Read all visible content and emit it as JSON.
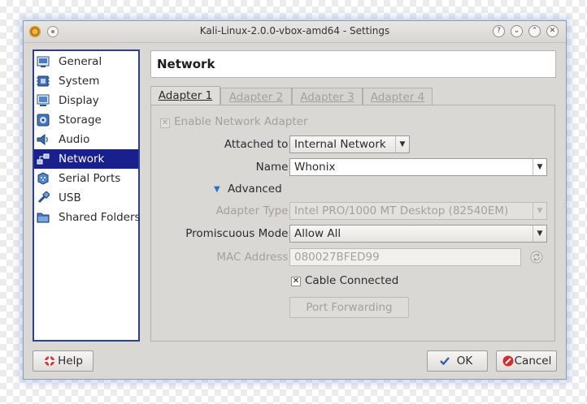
{
  "window": {
    "title": "Kali-Linux-2.0.0-vbox-amd64 - Settings"
  },
  "sidebar": {
    "items": [
      {
        "label": "General",
        "icon": "general-icon"
      },
      {
        "label": "System",
        "icon": "system-icon"
      },
      {
        "label": "Display",
        "icon": "display-icon"
      },
      {
        "label": "Storage",
        "icon": "storage-icon"
      },
      {
        "label": "Audio",
        "icon": "audio-icon"
      },
      {
        "label": "Network",
        "icon": "network-icon",
        "selected": true
      },
      {
        "label": "Serial Ports",
        "icon": "serial-ports-icon"
      },
      {
        "label": "USB",
        "icon": "usb-icon"
      },
      {
        "label": "Shared Folders",
        "icon": "shared-folders-icon"
      }
    ]
  },
  "page": {
    "title": "Network"
  },
  "tabs": [
    {
      "label": "Adapter 1",
      "active": true
    },
    {
      "label": "Adapter 2"
    },
    {
      "label": "Adapter 3"
    },
    {
      "label": "Adapter 4"
    }
  ],
  "adapter": {
    "enable_label": "Enable Network Adapter",
    "enable_checked": true,
    "attached_label": "Attached to:",
    "attached_value": "Internal Network",
    "name_label": "Name:",
    "name_value": "Whonix",
    "advanced_label": "Advanced",
    "adapter_type_label": "Adapter Type:",
    "adapter_type_value": "Intel PRO/1000 MT Desktop (82540EM)",
    "promiscuous_label": "Promiscuous Mode:",
    "promiscuous_value": "Allow All",
    "mac_label": "MAC Address:",
    "mac_value": "080027BFED99",
    "cable_label": "Cable Connected",
    "cable_checked": true,
    "port_forwarding_label": "Port Forwarding"
  },
  "footer": {
    "help_label": "Help",
    "ok_label": "OK",
    "cancel_label": "Cancel"
  },
  "colors": {
    "selection": "#19208d",
    "window_bg": "#dad8d4",
    "sidebar_border": "#2e3f8e"
  }
}
